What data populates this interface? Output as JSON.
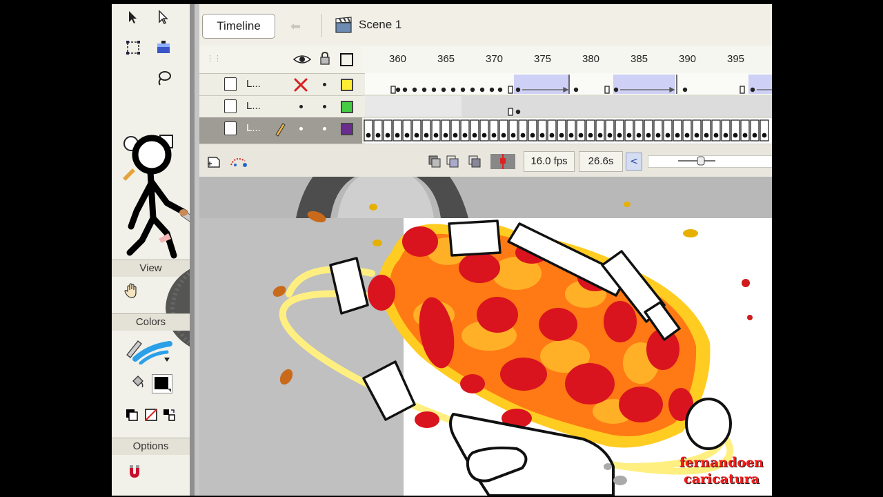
{
  "window": {
    "background": "#ece9d8"
  },
  "tools": {
    "view_label": "View",
    "colors_label": "Colors",
    "options_label": "Options"
  },
  "timeline": {
    "tab_label": "Timeline",
    "scene_label": "Scene 1",
    "ruler": [
      "360",
      "365",
      "370",
      "375",
      "380",
      "385",
      "390",
      "395"
    ],
    "layers": [
      {
        "name": "L...",
        "color": "#ffee33",
        "visible_icon": "x-icon"
      },
      {
        "name": "L...",
        "color": "#44cc44",
        "visible_icon": "dot"
      },
      {
        "name": "L...",
        "color": "#6a2c8e",
        "visible_icon": "pencil-icon",
        "selected": true
      }
    ],
    "fps": "16.0 fps",
    "time": "26.6s"
  },
  "stage": {
    "watermark_line1": "fernandoen",
    "watermark_line2": "caricatura"
  },
  "colors": {
    "fire_red": "#d9141e",
    "fire_orange": "#ff7a14",
    "fire_yellow": "#ffd21e",
    "ring_yellow": "#fff27a"
  }
}
